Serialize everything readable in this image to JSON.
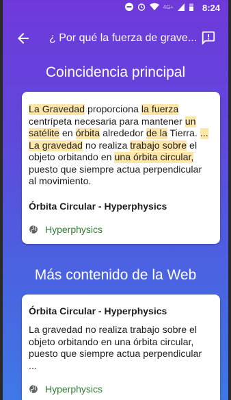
{
  "status_bar": {
    "network_label": "4G+",
    "time": "8:24"
  },
  "app_bar": {
    "title": "¿ Por qué la fuerza de grave..."
  },
  "sections": {
    "top_match_heading": "Coincidencia principal",
    "more_heading": "Más contenido de la Web"
  },
  "card1": {
    "segments": [
      {
        "t": "La Gravedad",
        "h": true
      },
      {
        "t": " proporciona ",
        "h": false
      },
      {
        "t": "la fuerza",
        "h": true
      },
      {
        "t": " centrípeta necesaria para mantener ",
        "h": false
      },
      {
        "t": "un",
        "h": true
      },
      {
        "t": " ",
        "h": false
      },
      {
        "t": "satélite",
        "h": true
      },
      {
        "t": " en ",
        "h": false
      },
      {
        "t": "órbita",
        "h": true
      },
      {
        "t": " alrededor ",
        "h": false
      },
      {
        "t": "de la",
        "h": true
      },
      {
        "t": " Tierra. ",
        "h": false
      },
      {
        "t": "...",
        "h": true
      },
      {
        "t": " ",
        "h": false
      },
      {
        "t": "La gravedad",
        "h": true
      },
      {
        "t": " no realiza ",
        "h": false
      },
      {
        "t": "trabajo sobre",
        "h": true
      },
      {
        "t": " el objeto orbitando en ",
        "h": false
      },
      {
        "t": "una órbita circular,",
        "h": true
      },
      {
        "t": " puesto que siempre actua perpendicular al movimiento.",
        "h": false
      }
    ],
    "source_title": "Órbita Circular - Hyperphysics",
    "source_name": "Hyperphysics"
  },
  "card2": {
    "source_title": "Órbita Circular - Hyperphysics",
    "snippet": "La gravedad no realiza trabajo sobre el objeto orbitando en una órbita circular, puesto que siempre actua perpendicular ...",
    "source_name": "Hyperphysics"
  },
  "colors": {
    "gradient_top": "#6f39d9",
    "gradient_bottom": "#3f78e6",
    "highlight": "#fde7a8",
    "link_green": "#2e7d32"
  },
  "icons": {
    "back": "arrow-left-icon",
    "report": "feedback-icon",
    "source": "globe-icon"
  }
}
